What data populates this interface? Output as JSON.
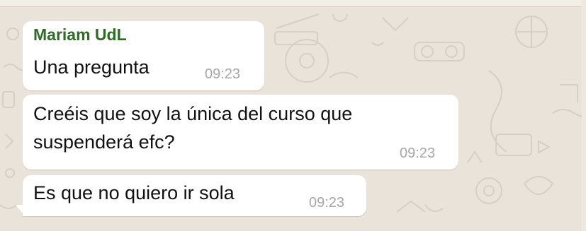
{
  "chat": {
    "messages": [
      {
        "sender": "Mariam UdL",
        "lines": [
          "Una pregunta"
        ],
        "time": "09:23"
      },
      {
        "lines": [
          "Creéis que soy la única del curso que",
          "suspenderá efc?"
        ],
        "time": "09:23"
      },
      {
        "lines": [
          "Es que no quiero ir sola"
        ],
        "time": "09:23"
      }
    ]
  },
  "colors": {
    "background": "#e9e3d9",
    "bubble": "#ffffff",
    "sender_name": "#2f6b27",
    "timestamp": "#a7a7a7",
    "text": "#111111"
  }
}
